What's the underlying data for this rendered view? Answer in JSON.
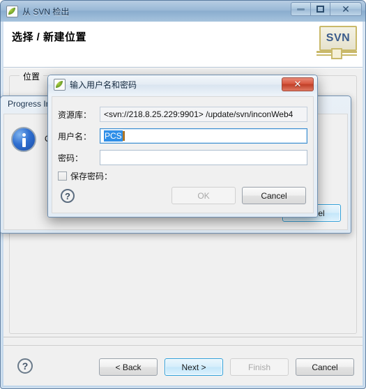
{
  "window": {
    "title": "从 SVN 检出",
    "icon": "leaf-icon",
    "minimize_label": "最小化",
    "maximize_label": "最大化",
    "close_label": "✕"
  },
  "header": {
    "page_title": "选择 / 新建位置",
    "logo_text": "SVN"
  },
  "body": {
    "group_legend": "位置"
  },
  "footer": {
    "help_label": "?",
    "buttons": [
      {
        "label": "< Back",
        "state": "enabled"
      },
      {
        "label": "Next >",
        "state": "default"
      },
      {
        "label": "Finish",
        "state": "disabled"
      },
      {
        "label": "Cancel",
        "state": "enabled"
      }
    ]
  },
  "progress_dialog": {
    "title": "Progress In",
    "icon": "info-icon",
    "message": "O",
    "cancel_label": "Cancel"
  },
  "modal": {
    "title": "输入用户名和密码",
    "icon": "leaf-icon",
    "close_label": "✕",
    "fields": [
      {
        "label": "资源库：",
        "value": "<svn://218.8.25.229:9901> /update/svn/inconWeb4",
        "readonly": true
      },
      {
        "label": "用户名：",
        "value": "PCS",
        "readonly": false
      },
      {
        "label": "密码：",
        "value": "",
        "readonly": false
      }
    ],
    "checkbox": {
      "label": "保存密码：",
      "checked": false
    },
    "help_label": "?",
    "ok_label": "OK",
    "cancel_label": "Cancel"
  },
  "colors": {
    "titlebar_blue": "#9ab9d6",
    "close_red": "#c03f28",
    "selection_blue": "#2f8fe8",
    "default_button_border": "#2e9fd9",
    "info_blue": "#1b4ea8",
    "logo_gold": "#c9b96a"
  }
}
